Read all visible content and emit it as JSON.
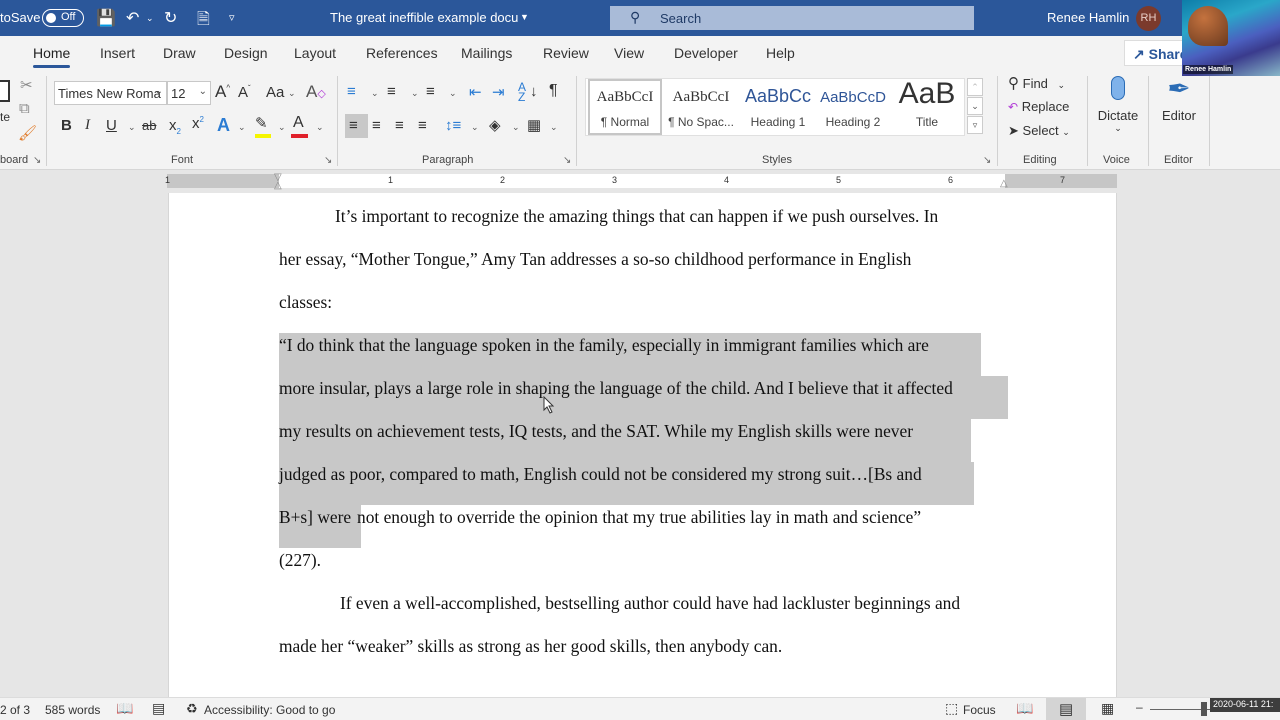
{
  "titlebar": {
    "autosave_label": "toSave",
    "autosave_state": "Off",
    "doc_title": "The great ineffible example docu",
    "search_placeholder": "Search",
    "user_name": "Renee Hamlin",
    "user_initials": "RH",
    "webcam_name": "Renee Hamlin"
  },
  "tabs": [
    {
      "label": "Home",
      "active": true
    },
    {
      "label": "Insert"
    },
    {
      "label": "Draw"
    },
    {
      "label": "Design"
    },
    {
      "label": "Layout"
    },
    {
      "label": "References"
    },
    {
      "label": "Mailings"
    },
    {
      "label": "Review"
    },
    {
      "label": "View"
    },
    {
      "label": "Developer"
    },
    {
      "label": "Help"
    }
  ],
  "share_label": "Share",
  "ribbon": {
    "clipboard": {
      "label": "board",
      "paste_label": "te"
    },
    "font": {
      "label": "Font",
      "font_name": "Times New Roma",
      "font_size": "12",
      "change_case": "Aa"
    },
    "paragraph": {
      "label": "Paragraph"
    },
    "styles": {
      "label": "Styles",
      "items": [
        {
          "sample": "AaBbCcI",
          "name": "¶ Normal",
          "selected": true
        },
        {
          "sample": "AaBbCcI",
          "name": "¶ No Spac..."
        },
        {
          "sample": "AaBbCc",
          "name": "Heading 1"
        },
        {
          "sample": "AaBbCcD",
          "name": "Heading 2"
        },
        {
          "sample": "AaB",
          "name": "Title"
        }
      ]
    },
    "editing": {
      "label": "Editing",
      "find": "Find",
      "replace": "Replace",
      "select": "Select"
    },
    "voice": {
      "label": "Voice",
      "dictate": "Dictate"
    },
    "editor": {
      "label": "Editor",
      "editor": "Editor"
    }
  },
  "ruler": {
    "numbers": [
      "1",
      "1",
      "2",
      "3",
      "4",
      "5",
      "6",
      "7"
    ]
  },
  "document": {
    "lines": [
      "It’s important to recognize the amazing things that can happen if we push ourselves.  In",
      "her essay, “Mother Tongue,” Amy Tan addresses a so-so childhood performance in English",
      "classes:",
      "“I do think that the language spoken in the family, especially in immigrant families which are",
      "more insular, plays a large role in shaping the language of the child. And I believe that it affected",
      "my results on achievement tests, IQ tests, and the SAT. While my English skills were never",
      "judged as poor, compared to math, English could not be considered my strong suit…[Bs and",
      "B+s] were",
      " not enough to override the opinion that my true abilities lay in math and science”",
      "(227).",
      "If even a well-accomplished, bestselling author could have had lackluster beginnings and",
      "made her “weaker” skills as strong as her good skills, then anybody can."
    ]
  },
  "statusbar": {
    "page": "2 of 3",
    "words": "585 words",
    "accessibility": "Accessibility: Good to go",
    "focus": "Focus",
    "clock": "2020-06-11 21:"
  }
}
